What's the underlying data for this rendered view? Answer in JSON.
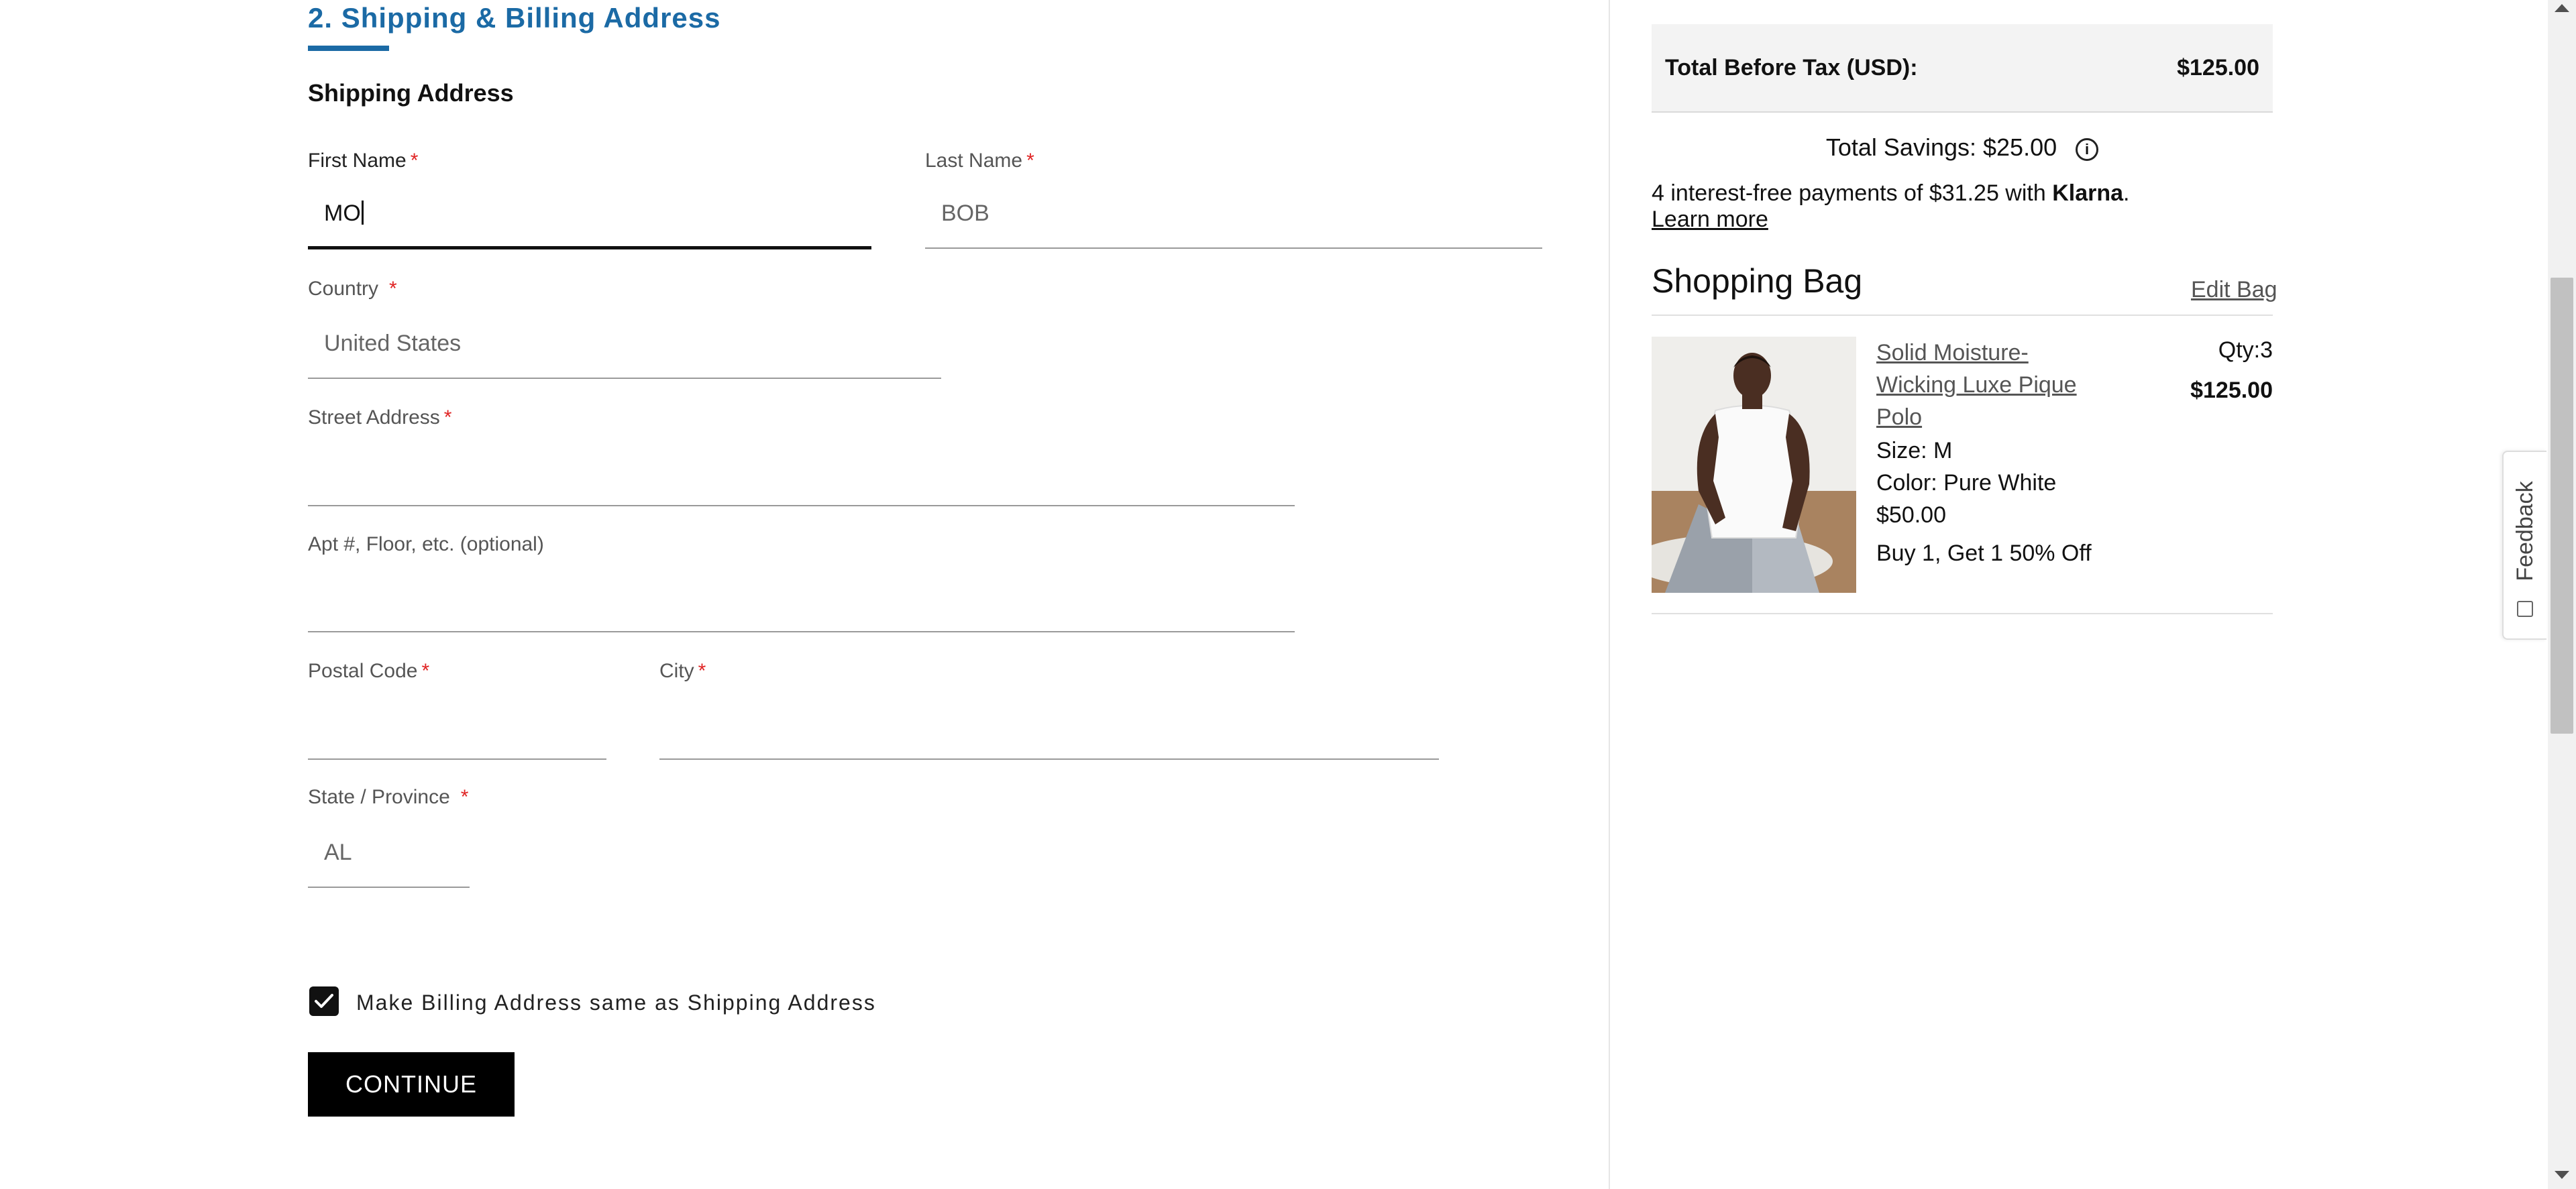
{
  "form": {
    "section_title": "2. Shipping & Billing Address",
    "subsection_title": "Shipping Address",
    "required_marker": "*",
    "first_name": {
      "label": "First Name",
      "value": "MO"
    },
    "last_name": {
      "label": "Last Name",
      "value": "BOB"
    },
    "country": {
      "label": "Country",
      "value": "United States"
    },
    "street": {
      "label": "Street Address",
      "value": ""
    },
    "apt": {
      "label": "Apt #, Floor, etc. (optional)",
      "value": ""
    },
    "postal_code": {
      "label": "Postal Code",
      "value": ""
    },
    "city": {
      "label": "City",
      "value": ""
    },
    "state": {
      "label": "State / Province",
      "value": "AL"
    },
    "billing_same": {
      "label": "Make Billing Address same as Shipping Address",
      "checked": true
    },
    "continue_label": "CONTINUE"
  },
  "summary": {
    "total_label": "Total Before Tax (USD):",
    "total_value": "$125.00",
    "savings_text": "Total Savings: $25.00",
    "info_icon": "i",
    "klarna_text": "4 interest-free payments of $31.25 with",
    "klarna_brand": "Klarna",
    "klarna_period": ".",
    "learn_more": "Learn more"
  },
  "bag": {
    "title": "Shopping Bag",
    "edit_label": "Edit Bag",
    "item": {
      "name": "Solid Moisture-Wicking Luxe Pique Polo",
      "size": "Size: M",
      "color": "Color: Pure White",
      "unit_price": "$50.00",
      "promo": "Buy 1, Get 1 50% Off",
      "qty": "Qty:3",
      "price": "$125.00"
    }
  },
  "feedback": {
    "label": "Feedback"
  },
  "icons": {
    "checkbox": "checkmark-icon",
    "info": "info-icon",
    "feedback": "feedback-icon",
    "scroll_up": "scroll-up-arrow-icon",
    "scroll_down": "scroll-down-arrow-icon"
  },
  "colors": {
    "accent": "#1b6aa5",
    "required": "#e02424",
    "button_bg": "#000000"
  }
}
